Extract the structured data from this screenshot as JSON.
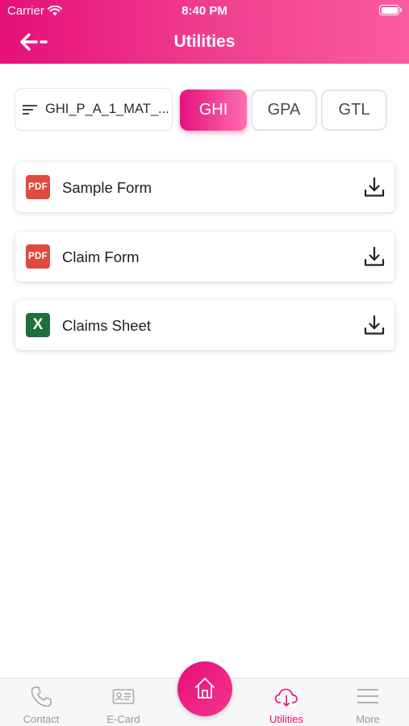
{
  "status_bar": {
    "carrier": "Carrier",
    "time": "8:40 PM"
  },
  "header": {
    "title": "Utilities"
  },
  "filter": {
    "policy_value": "GHI_P_A_1_MAT_...",
    "tabs": [
      {
        "label": "GHI",
        "active": true
      },
      {
        "label": "GPA",
        "active": false
      },
      {
        "label": "GTL",
        "active": false
      }
    ]
  },
  "files": [
    {
      "type_label": "PDF",
      "name": "Sample Form"
    },
    {
      "type_label": "PDF",
      "name": "Claim Form"
    },
    {
      "type_label": "X",
      "name": "Claims Sheet"
    }
  ],
  "bottom_nav": {
    "items": [
      {
        "label": "Contact",
        "icon": "phone-icon"
      },
      {
        "label": "E-Card",
        "icon": "id-card-icon"
      },
      {
        "label": "Utilities",
        "icon": "cloud-download-icon",
        "active": true
      },
      {
        "label": "More",
        "icon": "menu-icon"
      }
    ],
    "home_icon": "home-icon"
  },
  "colors": {
    "accent": "#e60f79",
    "pdf": "#e04a3e",
    "excel": "#1e6e3e",
    "inactive_nav": "#9a9a9a"
  }
}
